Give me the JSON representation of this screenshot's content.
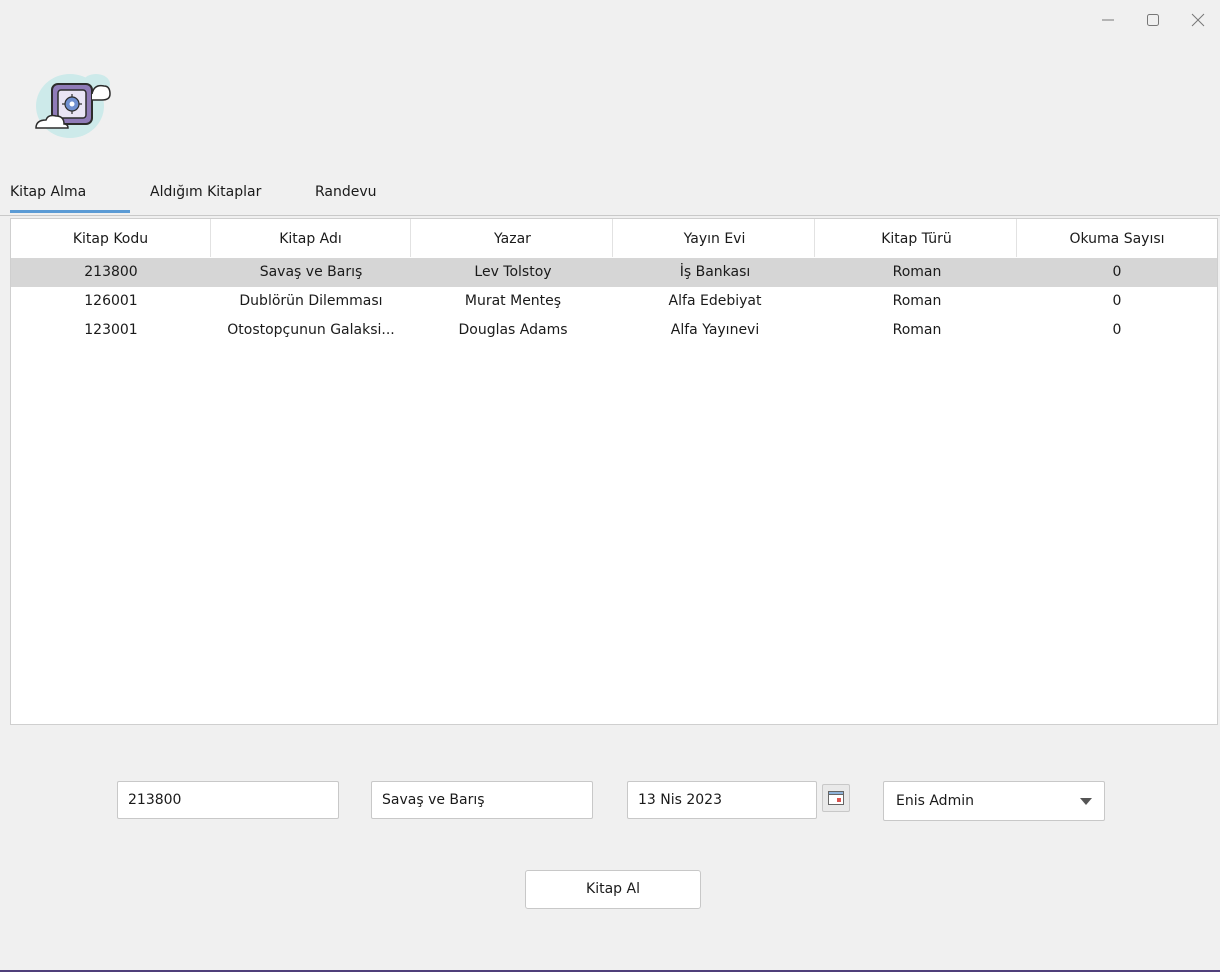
{
  "window": {
    "controls": [
      "minimize",
      "maximize",
      "close"
    ]
  },
  "tabs": [
    {
      "label": "Kitap Alma",
      "active": true
    },
    {
      "label": "Aldığım Kitaplar",
      "active": false
    },
    {
      "label": "Randevu",
      "active": false
    }
  ],
  "table": {
    "columns": [
      "Kitap Kodu",
      "Kitap Adı",
      "Yazar",
      "Yayın Evi",
      "Kitap Türü",
      "Okuma Sayısı"
    ],
    "rows": [
      [
        "213800",
        "Savaş ve Barış",
        "Lev Tolstoy",
        "İş Bankası",
        "Roman",
        "0"
      ],
      [
        "126001",
        "Dublörün Dilemması",
        "Murat Menteş",
        "Alfa Edebiyat",
        "Roman",
        "0"
      ],
      [
        "123001",
        "Otostopçunun Galaksi...",
        "Douglas Adams",
        "Alfa Yayınevi",
        "Roman",
        "0"
      ]
    ],
    "selected_row": 0
  },
  "form": {
    "book_code": "213800",
    "book_name": "Savaş ve Barış",
    "date": "13 Nis 2023",
    "user_selected": "Enis Admin",
    "submit_label": "Kitap Al"
  },
  "colors": {
    "accent": "#5b9bd5",
    "selection": "#d6d6d6",
    "background": "#f0f0f0"
  }
}
